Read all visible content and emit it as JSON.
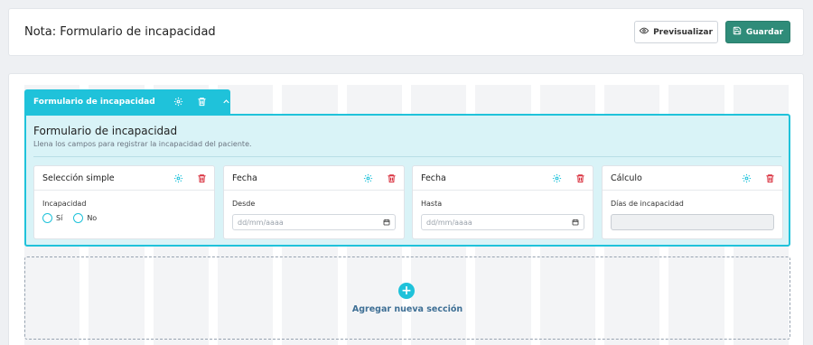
{
  "header": {
    "title": "Nota: Formulario de incapacidad",
    "preview_label": "Previsualizar",
    "save_label": "Guardar"
  },
  "section": {
    "tab_label": "Formulario de incapacidad",
    "title": "Formulario de incapacidad",
    "description": "Llena los campos para registrar la incapacidad del paciente."
  },
  "cards": [
    {
      "title": "Selección simple",
      "field_label": "Incapacidad",
      "options": [
        "Sí",
        "No"
      ]
    },
    {
      "title": "Fecha",
      "field_label": "Desde",
      "placeholder": "dd/mm/aaaa"
    },
    {
      "title": "Fecha",
      "field_label": "Hasta",
      "placeholder": "dd/mm/aaaa"
    },
    {
      "title": "Cálculo",
      "field_label": "Días de incapacidad"
    }
  ],
  "add_section": {
    "label": "Agregar nueva sección"
  },
  "colors": {
    "accent": "#1fc2da",
    "save": "#2f8c79",
    "danger": "#d9303e",
    "link": "#3e6f95"
  },
  "icons": [
    "eye-icon",
    "save-icon",
    "gear-icon",
    "trash-icon",
    "chevron-up-icon",
    "calendar-icon",
    "plus-icon"
  ]
}
